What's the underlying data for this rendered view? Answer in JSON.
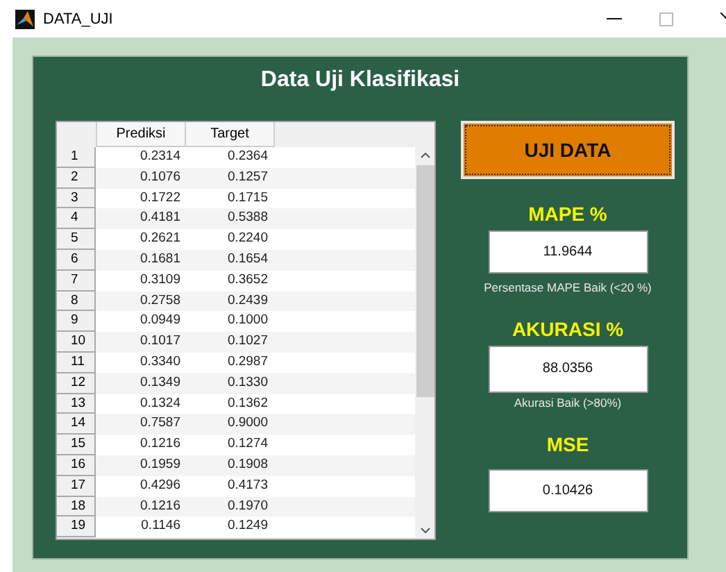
{
  "window": {
    "title": "DATA_UJI"
  },
  "panel": {
    "title": "Data Uji Klasifikasi"
  },
  "table": {
    "columns": [
      "Prediksi",
      "Target"
    ],
    "rows": [
      {
        "label": "1",
        "cells": [
          "0.2314",
          "0.2364"
        ]
      },
      {
        "label": "2",
        "cells": [
          "0.1076",
          "0.1257"
        ]
      },
      {
        "label": "3",
        "cells": [
          "0.1722",
          "0.1715"
        ]
      },
      {
        "label": "4",
        "cells": [
          "0.4181",
          "0.5388"
        ]
      },
      {
        "label": "5",
        "cells": [
          "0.2621",
          "0.2240"
        ]
      },
      {
        "label": "6",
        "cells": [
          "0.1681",
          "0.1654"
        ]
      },
      {
        "label": "7",
        "cells": [
          "0.3109",
          "0.3652"
        ]
      },
      {
        "label": "8",
        "cells": [
          "0.2758",
          "0.2439"
        ]
      },
      {
        "label": "9",
        "cells": [
          "0.0949",
          "0.1000"
        ]
      },
      {
        "label": "10",
        "cells": [
          "0.1017",
          "0.1027"
        ]
      },
      {
        "label": "11",
        "cells": [
          "0.3340",
          "0.2987"
        ]
      },
      {
        "label": "12",
        "cells": [
          "0.1349",
          "0.1330"
        ]
      },
      {
        "label": "13",
        "cells": [
          "0.1324",
          "0.1362"
        ]
      },
      {
        "label": "14",
        "cells": [
          "0.7587",
          "0.9000"
        ]
      },
      {
        "label": "15",
        "cells": [
          "0.1216",
          "0.1274"
        ]
      },
      {
        "label": "16",
        "cells": [
          "0.1959",
          "0.1908"
        ]
      },
      {
        "label": "17",
        "cells": [
          "0.4296",
          "0.4173"
        ]
      },
      {
        "label": "18",
        "cells": [
          "0.1216",
          "0.1970"
        ]
      },
      {
        "label": "19",
        "cells": [
          "0.1146",
          "0.1249"
        ]
      }
    ]
  },
  "button": {
    "label": "UJI DATA"
  },
  "metrics": [
    {
      "label": "MAPE %",
      "value": "11.9644",
      "note": "Persentase MAPE Baik (<20 %)"
    },
    {
      "label": "AKURASI %",
      "value": "88.0356",
      "note": "Akurasi Baik (>80%)"
    },
    {
      "label": "MSE",
      "value": "0.10426"
    }
  ]
}
